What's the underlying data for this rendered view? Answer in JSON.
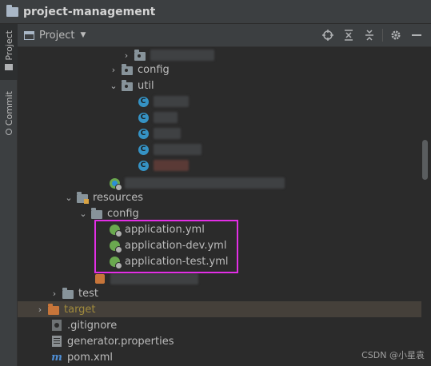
{
  "window": {
    "title": "project-management"
  },
  "left_strip": {
    "tabs": [
      {
        "label": "Project"
      },
      {
        "label": "Commit"
      }
    ]
  },
  "panel": {
    "view_selector": "Project"
  },
  "tree": {
    "config_pkg": "config",
    "util_pkg": "util",
    "resources": "resources",
    "resources_config": "config",
    "yml_files": [
      "application.yml",
      "application-dev.yml",
      "application-test.yml"
    ],
    "test": "test",
    "target": "target",
    "gitignore": ".gitignore",
    "generator": "generator.properties",
    "pom": "pom.xml"
  },
  "watermark": "CSDN @小星袁",
  "colors": {
    "highlight": "#e32ee6",
    "selected_row": "#45403a",
    "accent_blue": "#3592c4",
    "excluded_folder": "#c7753a"
  }
}
